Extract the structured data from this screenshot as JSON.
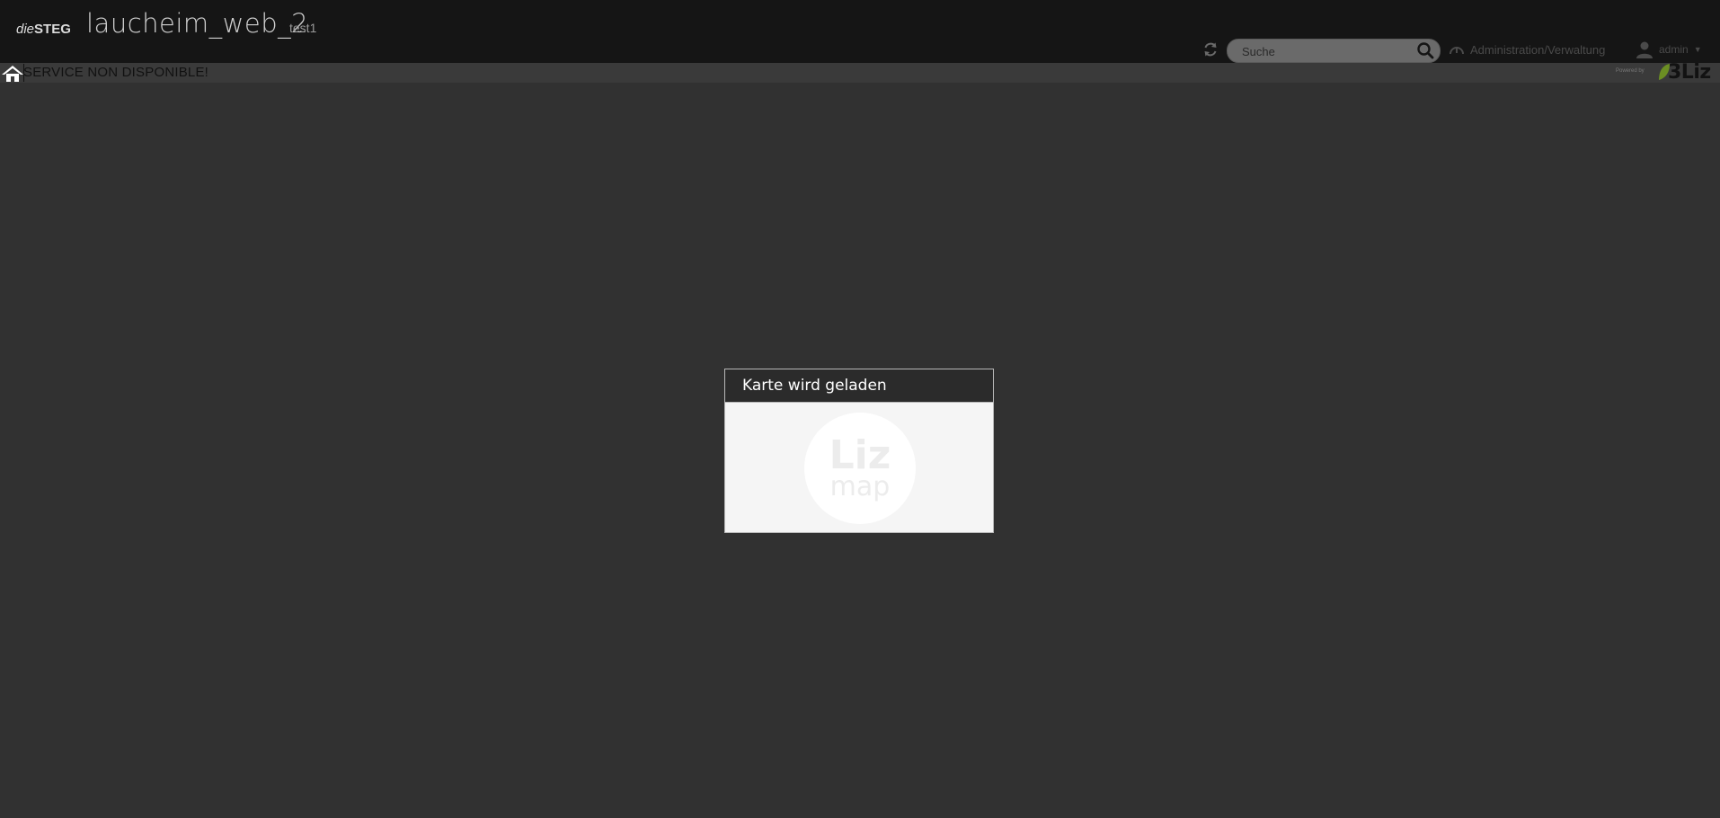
{
  "header": {
    "brand_prefix": "die",
    "brand_name": "STEG",
    "project_title": "laucheim_web_2",
    "project_subtitle": "test1",
    "search": {
      "placeholder": "Suche",
      "value": ""
    },
    "admin_label": "Administration/Verwaltung",
    "user_label": "admin"
  },
  "subbar": {
    "message": "SERVICE NON DISPONIBLE!",
    "powered_by": "Powered by",
    "logo_text": "3Liz"
  },
  "dialog": {
    "title": "Karte wird geladen",
    "logo_top": "Liz",
    "logo_bottom": "map"
  },
  "icons": {
    "refresh": "refresh-icon",
    "search": "search-icon",
    "admin": "dashboard-icon",
    "user": "user-icon",
    "home": "home-icon"
  },
  "colors": {
    "page_background": "#313131",
    "header_background": "#151515",
    "dialog_header": "#2b2b2b",
    "dialog_body": "#f5f5f5",
    "liz_green": "#6b8e23"
  }
}
